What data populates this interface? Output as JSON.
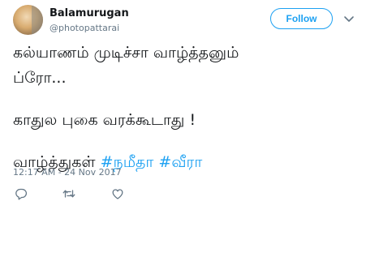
{
  "user": {
    "display_name": "Balamurugan",
    "handle": "@photopattarai"
  },
  "follow_label": "Follow",
  "tweet": {
    "lines": [
      "கல்யாணம் முடிச்சா வாழ்த்தனும்",
      "ப்ரோ...",
      "காதுல புகை வரக்கூடாது !",
      "வாழ்த்துகள் "
    ],
    "hashtags": [
      "#நமீதா",
      "#வீரா"
    ]
  },
  "timestamp": "12:17 AM - 24 Nov 2017",
  "colors": {
    "accent": "#1da1f2",
    "text": "#14171a",
    "muted": "#657786"
  },
  "icons": {
    "more": "chevron-down-icon",
    "reply": "reply-icon",
    "retweet": "retweet-icon",
    "like": "heart-icon"
  }
}
